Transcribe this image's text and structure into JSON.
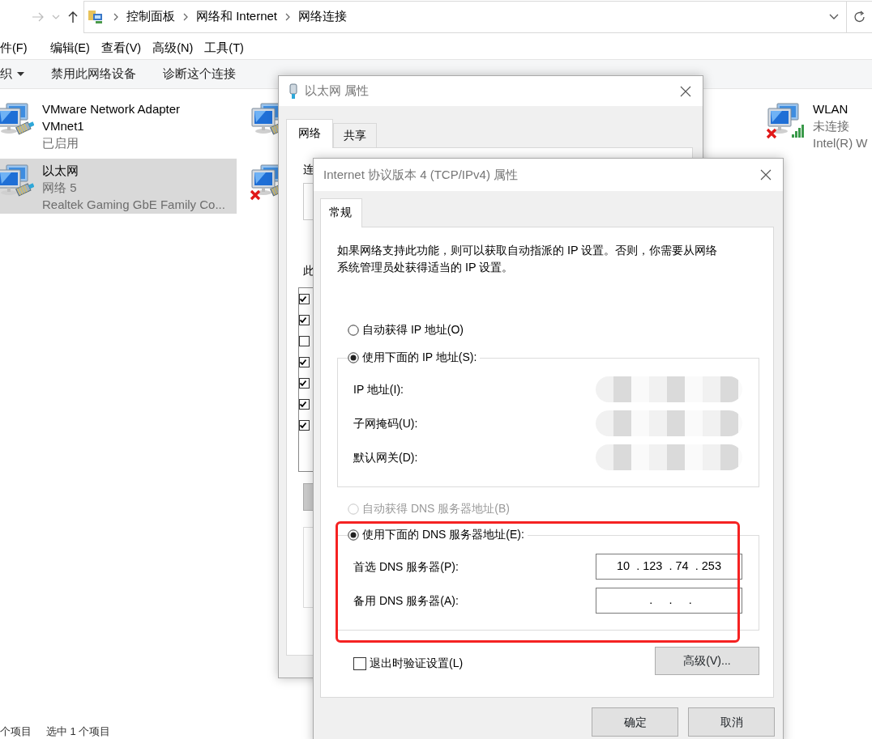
{
  "address_bar": {
    "breadcrumbs": [
      "控制面板",
      "网络和 Internet",
      "网络连接"
    ]
  },
  "menu_bar": [
    "件(F)",
    "编辑(E)",
    "查看(V)",
    "高级(N)",
    "工具(T)"
  ],
  "toolbar": [
    {
      "label": "织",
      "dropdown": true
    },
    {
      "label": "禁用此网络设备",
      "dropdown": false
    },
    {
      "label": "诊断这个连接",
      "dropdown": false
    }
  ],
  "adapter_columns": [
    [
      {
        "kind": "cable",
        "name": "VMware Network Adapter VMnet1",
        "status": "已启用",
        "disconnected": false,
        "selected": false
      },
      {
        "kind": "cable",
        "name": "以太网",
        "status": "网络 5",
        "device": "Realtek Gaming GbE Family Co...",
        "disconnected": false,
        "selected": true
      }
    ],
    [
      {
        "kind": "cable",
        "disconnected": false,
        "selected": false
      },
      {
        "kind": "cable",
        "disconnected": true,
        "selected": false
      }
    ],
    [
      {
        "kind": "wifi",
        "name": "WLAN",
        "status": "未连接",
        "device": "Intel(R) W",
        "disconnected": true,
        "selected": false
      }
    ]
  ],
  "status_bar": [
    "个项目",
    "选中 1 个项目"
  ],
  "eth_dialog": {
    "title": "以太网 属性",
    "tabs": [
      {
        "label": "网络",
        "selected": true
      },
      {
        "label": "共享",
        "selected": false
      }
    ],
    "labels": [
      "连",
      "此"
    ],
    "components": [
      {
        "checked": true
      },
      {
        "checked": true
      },
      {
        "checked": false
      },
      {
        "checked": true
      },
      {
        "checked": true
      },
      {
        "checked": true
      },
      {
        "checked": true
      }
    ]
  },
  "ipv4_dialog": {
    "title": "Internet 协议版本 4 (TCP/IPv4) 属性",
    "tabs": [
      {
        "label": "常规",
        "selected": true
      }
    ],
    "description": "如果网络支持此功能，则可以获取自动指派的 IP 设置。否则，你需要从网络系统管理员处获得适当的 IP 设置。",
    "ip_options": [
      {
        "label": "自动获得 IP 地址(O)",
        "selected": false,
        "disabled": false
      },
      {
        "label": "使用下面的 IP 地址(S):",
        "selected": true,
        "disabled": false
      }
    ],
    "ip_fields": [
      {
        "label": "IP 地址(I):",
        "kind": "redacted"
      },
      {
        "label": "子网掩码(U):",
        "kind": "redacted"
      },
      {
        "label": "默认网关(D):",
        "kind": "redacted"
      }
    ],
    "dns_options": [
      {
        "label": "自动获得 DNS 服务器地址(B)",
        "selected": false,
        "disabled": true
      },
      {
        "label": "使用下面的 DNS 服务器地址(E):",
        "selected": true,
        "disabled": false
      }
    ],
    "dns_fields": [
      {
        "label": "首选 DNS 服务器(P):",
        "kind": "ip",
        "octets": [
          "10",
          "123",
          "74",
          "253"
        ]
      },
      {
        "label": "备用 DNS 服务器(A):",
        "kind": "ip"
      }
    ],
    "separator": ".",
    "highlight_dns": true,
    "validate": {
      "label": "退出时验证设置(L)",
      "checked": false
    },
    "advanced_button": "高级(V)...",
    "buttons": [
      "确定",
      "取消"
    ]
  }
}
